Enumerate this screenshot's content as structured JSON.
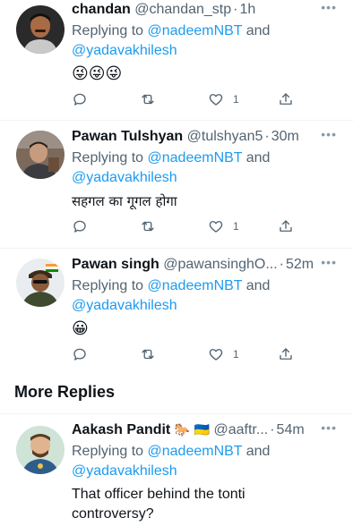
{
  "replies": [
    {
      "name": "chandan",
      "handle": "@chandan_stp",
      "time": "1h",
      "replying_prefix": "Replying to",
      "mention1": "@nadeemNBT",
      "and": "and",
      "mention2": "@yadavakhilesh",
      "text": "😜😜😜",
      "like_count": "1",
      "avatar_icon": "man-portrait-avatar"
    },
    {
      "name": "Pawan Tulshyan",
      "handle": "@tulshyan5",
      "time": "30m",
      "replying_prefix": "Replying to",
      "mention1": "@nadeemNBT",
      "and": "and",
      "mention2": "@yadavakhilesh",
      "text": "सहगल का गूगल होगा",
      "like_count": "1",
      "avatar_icon": "man-photo-avatar"
    },
    {
      "name": "Pawan singh",
      "handle": "@pawansinghO...",
      "time": "52m",
      "replying_prefix": "Replying to",
      "mention1": "@nadeemNBT",
      "and": "and",
      "mention2": "@yadavakhilesh",
      "text": "😀",
      "like_count": "1",
      "avatar_icon": "cartoon-avatar-with-flag"
    }
  ],
  "more_replies": {
    "title": "More Replies",
    "item": {
      "name": "Aakash Pandit",
      "badges": "🐎 🇺🇦",
      "handle": "@aaftr...",
      "time": "54m",
      "replying_prefix": "Replying to",
      "mention1": "@nadeemNBT",
      "and": "and",
      "mention2": "@yadavakhilesh",
      "text_line1": "That officer behind the tonti",
      "text_line2": "controversy?",
      "avatar_icon": "cartoon-man-avatar"
    }
  },
  "more_icon": "•••",
  "colors": {
    "link": "#1d9bf0",
    "muted": "#536471",
    "text": "#0f1419",
    "divider": "#eff3f4"
  }
}
